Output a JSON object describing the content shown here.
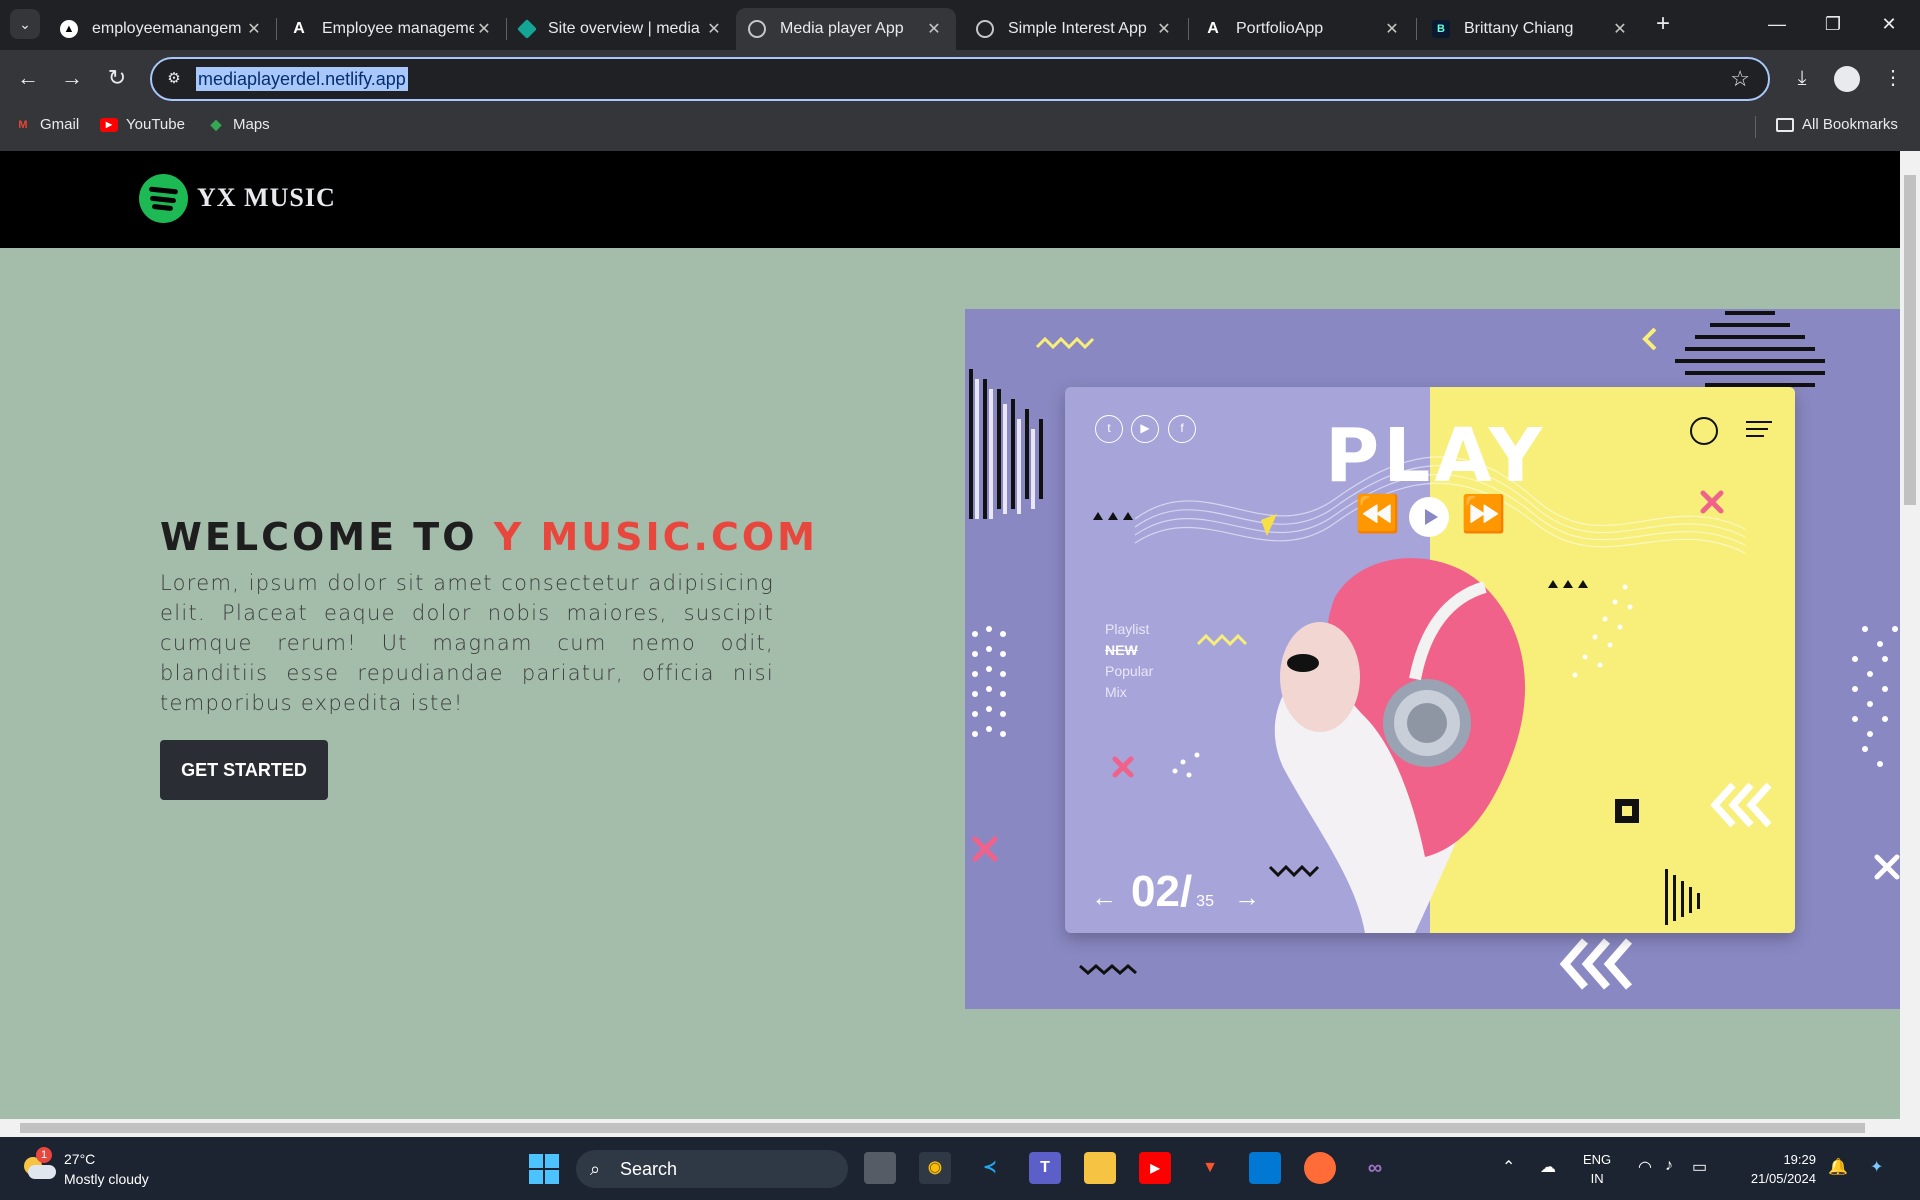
{
  "browser": {
    "tabs": [
      {
        "title": "employeemanangem",
        "favicon": "angular-icon"
      },
      {
        "title": "Employee manageme",
        "favicon": "angular-icon"
      },
      {
        "title": "Site overview | media",
        "favicon": "netlify-icon"
      },
      {
        "title": "Media player App",
        "favicon": "globe-icon",
        "active": true
      },
      {
        "title": "Simple Interest App",
        "favicon": "globe-icon"
      },
      {
        "title": "PortfolioApp",
        "favicon": "angular-icon"
      },
      {
        "title": "Brittany Chiang",
        "favicon": "b-icon"
      }
    ],
    "url": "mediaplayerdel.netlify.app",
    "bookmarks": [
      {
        "label": "Gmail",
        "icon": "gmail-icon"
      },
      {
        "label": "YouTube",
        "icon": "youtube-icon"
      },
      {
        "label": "Maps",
        "icon": "maps-icon"
      }
    ],
    "all_bookmarks": "All Bookmarks"
  },
  "site": {
    "brand": "YX MUSIC",
    "hero": {
      "title_prefix": "WELCOME TO ",
      "title_accent": "Y MUSIC.COM",
      "body": "Lorem, ipsum dolor sit amet consectetur adipisicing elit. Placeat eaque dolor nobis maiores, suscipit cumque rerum! Ut magnam cum nemo odit, blanditiis esse repudiandae pariatur, officia nisi temporibus expedita iste!",
      "cta": "GET STARTED"
    },
    "player": {
      "title": "PLAY",
      "playlist": [
        "Playlist",
        "NEW",
        "Popular",
        "Mix"
      ],
      "current": "02/",
      "total": "35"
    }
  },
  "taskbar": {
    "weather_temp": "27°C",
    "weather_desc": "Mostly cloudy",
    "weather_badge": "1",
    "search": "Search",
    "lang_1": "ENG",
    "lang_2": "IN",
    "time": "19:29",
    "date": "21/05/2024"
  },
  "colors": {
    "accent": "#e8473d",
    "page_bg": "#a4bcaa",
    "header_bg": "#000000",
    "spotify_green": "#1db954",
    "art_purple": "#8a88c2",
    "art_yellow": "#f7ef7a"
  }
}
